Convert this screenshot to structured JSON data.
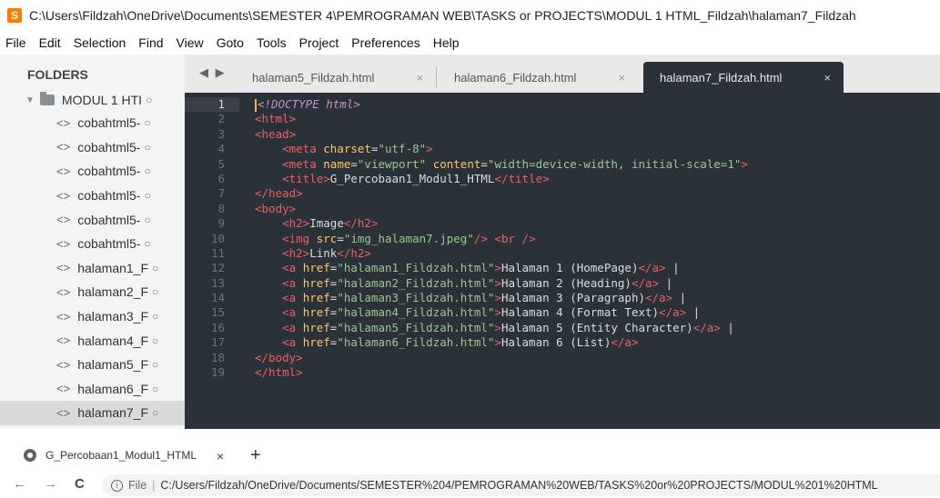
{
  "window": {
    "title": "C:\\Users\\Fildzah\\OneDrive\\Documents\\SEMESTER 4\\PEMROGRAMAN WEB\\TASKS or PROJECTS\\MODUL 1 HTML_Fildzah\\halaman7_Fildzah"
  },
  "menu": [
    "File",
    "Edit",
    "Selection",
    "Find",
    "View",
    "Goto",
    "Tools",
    "Project",
    "Preferences",
    "Help"
  ],
  "sidebar": {
    "heading": "FOLDERS",
    "folder": "MODUL 1 HTI",
    "files": [
      "cobahtml5-",
      "cobahtml5-",
      "cobahtml5-",
      "cobahtml5-",
      "cobahtml5-",
      "cobahtml5-",
      "halaman1_F",
      "halaman2_F",
      "halaman3_F",
      "halaman4_F",
      "halaman5_F",
      "halaman6_F",
      "halaman7_F"
    ],
    "selected_index": 12
  },
  "tabs": [
    {
      "label": "halaman5_Fildzah.html",
      "active": false
    },
    {
      "label": "halaman6_Fildzah.html",
      "active": false
    },
    {
      "label": "halaman7_Fildzah.html",
      "active": true
    }
  ],
  "editor": {
    "current_line": 1,
    "lines": [
      [
        [
          "doc",
          "<!DOCTYPE html>"
        ]
      ],
      [
        [
          "tag",
          "<html>"
        ]
      ],
      [
        [
          "tag",
          "<head>"
        ]
      ],
      [
        [
          "txt",
          "    "
        ],
        [
          "tag",
          "<meta "
        ],
        [
          "attr",
          "charset"
        ],
        [
          "txt",
          "="
        ],
        [
          "str",
          "\"utf-8\""
        ],
        [
          "tag",
          ">"
        ]
      ],
      [
        [
          "txt",
          "    "
        ],
        [
          "tag",
          "<meta "
        ],
        [
          "attr",
          "name"
        ],
        [
          "txt",
          "="
        ],
        [
          "str",
          "\"viewport\""
        ],
        [
          "txt",
          " "
        ],
        [
          "attr",
          "content"
        ],
        [
          "txt",
          "="
        ],
        [
          "str",
          "\"width=device-width, initial-scale=1\""
        ],
        [
          "tag",
          ">"
        ]
      ],
      [
        [
          "txt",
          "    "
        ],
        [
          "tag",
          "<title>"
        ],
        [
          "txt",
          "G_Percobaan1_Modul1_HTML"
        ],
        [
          "tag",
          "</title>"
        ]
      ],
      [
        [
          "tag",
          "</head>"
        ]
      ],
      [
        [
          "tag",
          "<body>"
        ]
      ],
      [
        [
          "txt",
          "    "
        ],
        [
          "tag",
          "<h2>"
        ],
        [
          "txt",
          "Image"
        ],
        [
          "tag",
          "</h2>"
        ]
      ],
      [
        [
          "txt",
          "    "
        ],
        [
          "tag",
          "<img "
        ],
        [
          "attr",
          "src"
        ],
        [
          "txt",
          "="
        ],
        [
          "str",
          "\"img_halaman7.jpeg\""
        ],
        [
          "tag",
          "/>"
        ],
        [
          "txt",
          " "
        ],
        [
          "tag",
          "<br />"
        ]
      ],
      [
        [
          "txt",
          "    "
        ],
        [
          "tag",
          "<h2>"
        ],
        [
          "txt",
          "Link"
        ],
        [
          "tag",
          "</h2>"
        ]
      ],
      [
        [
          "txt",
          "    "
        ],
        [
          "tag",
          "<a "
        ],
        [
          "attr",
          "href"
        ],
        [
          "txt",
          "="
        ],
        [
          "str",
          "\"halaman1_Fildzah.html\""
        ],
        [
          "tag",
          ">"
        ],
        [
          "txt",
          "Halaman 1 (HomePage)"
        ],
        [
          "tag",
          "</a>"
        ],
        [
          "txt",
          " |"
        ]
      ],
      [
        [
          "txt",
          "    "
        ],
        [
          "tag",
          "<a "
        ],
        [
          "attr",
          "href"
        ],
        [
          "txt",
          "="
        ],
        [
          "str",
          "\"halaman2_Fildzah.html\""
        ],
        [
          "tag",
          ">"
        ],
        [
          "txt",
          "Halaman 2 (Heading)"
        ],
        [
          "tag",
          "</a>"
        ],
        [
          "txt",
          " |"
        ]
      ],
      [
        [
          "txt",
          "    "
        ],
        [
          "tag",
          "<a "
        ],
        [
          "attr",
          "href"
        ],
        [
          "txt",
          "="
        ],
        [
          "str",
          "\"halaman3_Fildzah.html\""
        ],
        [
          "tag",
          ">"
        ],
        [
          "txt",
          "Halaman 3 (Paragraph)"
        ],
        [
          "tag",
          "</a>"
        ],
        [
          "txt",
          " |"
        ]
      ],
      [
        [
          "txt",
          "    "
        ],
        [
          "tag",
          "<a "
        ],
        [
          "attr",
          "href"
        ],
        [
          "txt",
          "="
        ],
        [
          "str",
          "\"halaman4_Fildzah.html\""
        ],
        [
          "tag",
          ">"
        ],
        [
          "txt",
          "Halaman 4 (Format Text)"
        ],
        [
          "tag",
          "</a>"
        ],
        [
          "txt",
          " |"
        ]
      ],
      [
        [
          "txt",
          "    "
        ],
        [
          "tag",
          "<a "
        ],
        [
          "attr",
          "href"
        ],
        [
          "txt",
          "="
        ],
        [
          "str",
          "\"halaman5_Fildzah.html\""
        ],
        [
          "tag",
          ">"
        ],
        [
          "txt",
          "Halaman 5 (Entity Character)"
        ],
        [
          "tag",
          "</a>"
        ],
        [
          "txt",
          " |"
        ]
      ],
      [
        [
          "txt",
          "    "
        ],
        [
          "tag",
          "<a "
        ],
        [
          "attr",
          "href"
        ],
        [
          "txt",
          "="
        ],
        [
          "str",
          "\"halaman6_Fildzah.html\""
        ],
        [
          "tag",
          ">"
        ],
        [
          "txt",
          "Halaman 6 (List)"
        ],
        [
          "tag",
          "</a>"
        ]
      ],
      [
        [
          "tag",
          "</body>"
        ]
      ],
      [
        [
          "tag",
          "</html>"
        ]
      ]
    ]
  },
  "browser": {
    "tab_title": "G_Percobaan1_Modul1_HTML",
    "close_glyph": "×",
    "new_tab_glyph": "+",
    "back_glyph": "←",
    "forward_glyph": "→",
    "reload_glyph": "C",
    "info_glyph": "i",
    "file_label": "File",
    "url": "C:/Users/Fildzah/OneDrive/Documents/SEMESTER%204/PEMROGRAMAN%20WEB/TASKS%20or%20PROJECTS/MODUL%201%20HTML"
  },
  "colors": {
    "editor_bg": "#2b3138",
    "tag": "#ec5f67",
    "attr": "#fac863",
    "string": "#99c794",
    "doctype": "#c594c5",
    "app_icon": "#ff7a00"
  }
}
